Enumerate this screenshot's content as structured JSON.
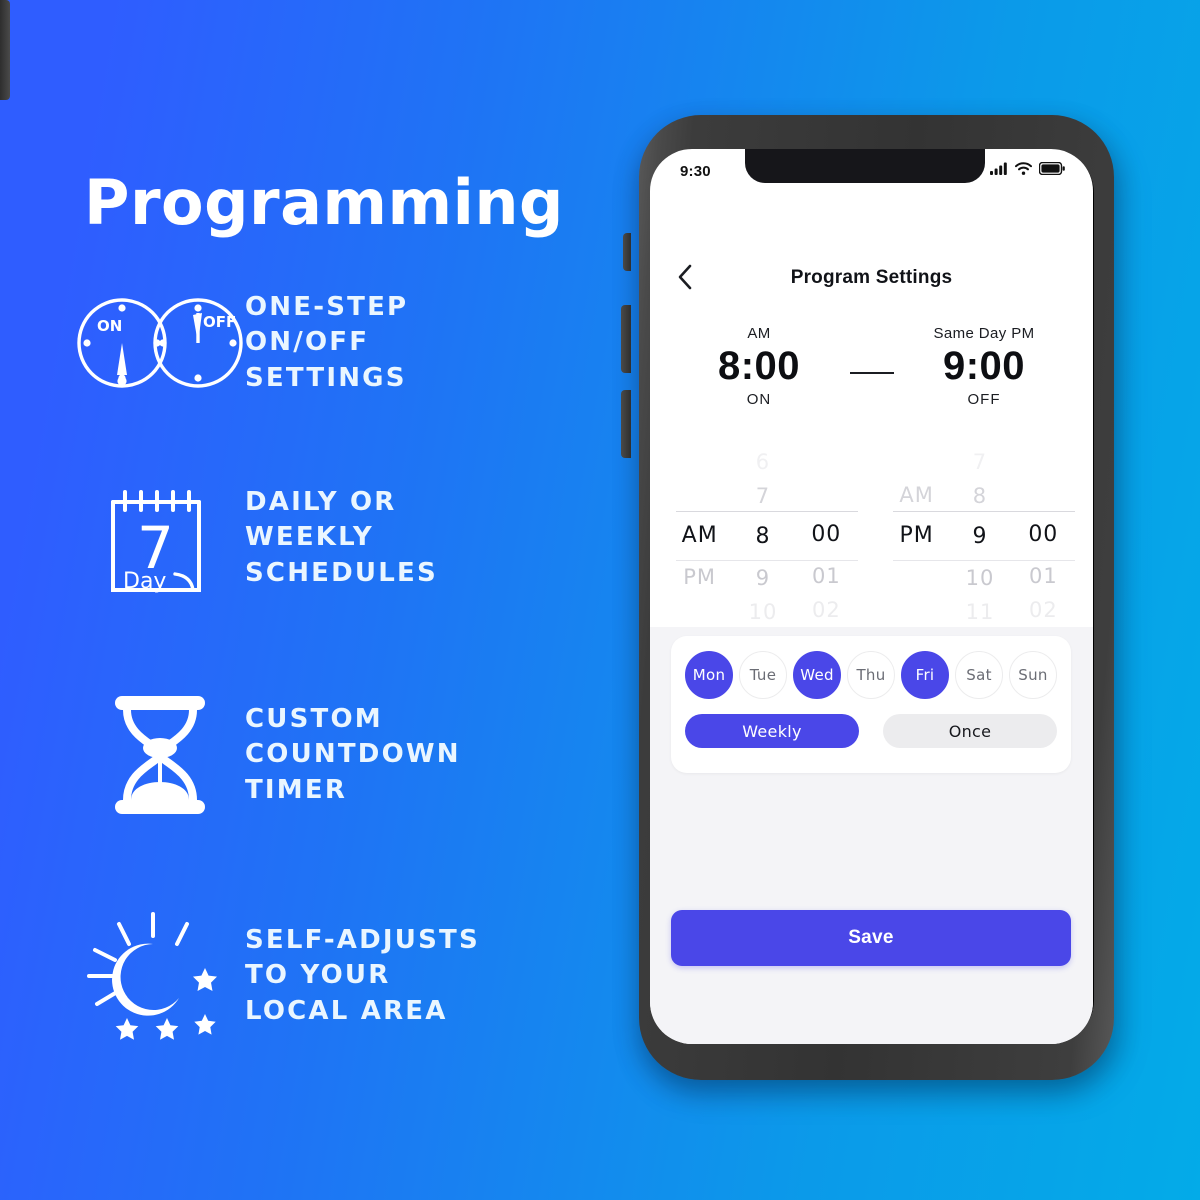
{
  "theme": {
    "bg_gradient_from": "#2f5dff",
    "bg_gradient_to": "#03abe8",
    "accent": "#4a47e8",
    "text_on_blue": "#eaf6ff"
  },
  "marketing": {
    "headline": "Programming",
    "features": [
      {
        "icon": "on-off-clocks-icon",
        "icon_labels": [
          "ON",
          "OFF"
        ],
        "lines": [
          "ONE-STEP",
          "ON/OFF",
          "SETTINGS"
        ]
      },
      {
        "icon": "calendar-7-day-icon",
        "icon_labels": [
          "7",
          "Day"
        ],
        "lines": [
          "DAILY OR",
          "WEEKLY",
          "SCHEDULES"
        ]
      },
      {
        "icon": "hourglass-icon",
        "icon_labels": [],
        "lines": [
          "CUSTOM",
          "COUNTDOWN",
          "TIMER"
        ]
      },
      {
        "icon": "sun-moon-stars-icon",
        "icon_labels": [],
        "lines": [
          "SELF-ADJUSTS",
          "TO YOUR",
          "LOCAL AREA"
        ]
      }
    ]
  },
  "phone": {
    "status_bar": {
      "time": "9:30",
      "icons": [
        "cellular-signal-icon",
        "wifi-icon",
        "battery-icon"
      ]
    },
    "nav": {
      "back_icon": "chevron-left-icon",
      "title": "Program Settings"
    },
    "summary": {
      "start": {
        "period": "AM",
        "time": "8:00",
        "state": "ON"
      },
      "separator": "—",
      "end": {
        "period": "Same Day PM",
        "time": "9:00",
        "state": "OFF"
      }
    },
    "pickers": {
      "start": {
        "meridiem": {
          "above2": "",
          "above1": "",
          "selected": "AM",
          "below1": "PM",
          "below2": ""
        },
        "hour": {
          "above2": "6",
          "above1": "7",
          "selected": "8",
          "below1": "9",
          "below2": "10"
        },
        "minute": {
          "above2": "",
          "above1": "",
          "selected": "00",
          "below1": "01",
          "below2": "02"
        }
      },
      "end": {
        "meridiem": {
          "above2": "",
          "above1": "AM",
          "selected": "PM",
          "below1": "",
          "below2": ""
        },
        "hour": {
          "above2": "7",
          "above1": "8",
          "selected": "9",
          "below1": "10",
          "below2": "11"
        },
        "minute": {
          "above2": "",
          "above1": "",
          "selected": "00",
          "below1": "01",
          "below2": "02"
        }
      }
    },
    "days": [
      {
        "label": "Mon",
        "selected": true
      },
      {
        "label": "Tue",
        "selected": false
      },
      {
        "label": "Wed",
        "selected": true
      },
      {
        "label": "Thu",
        "selected": false
      },
      {
        "label": "Fri",
        "selected": true
      },
      {
        "label": "Sat",
        "selected": false
      },
      {
        "label": "Sun",
        "selected": false
      }
    ],
    "repeat": [
      {
        "label": "Weekly",
        "selected": true
      },
      {
        "label": "Once",
        "selected": false
      }
    ],
    "save_label": "Save"
  }
}
